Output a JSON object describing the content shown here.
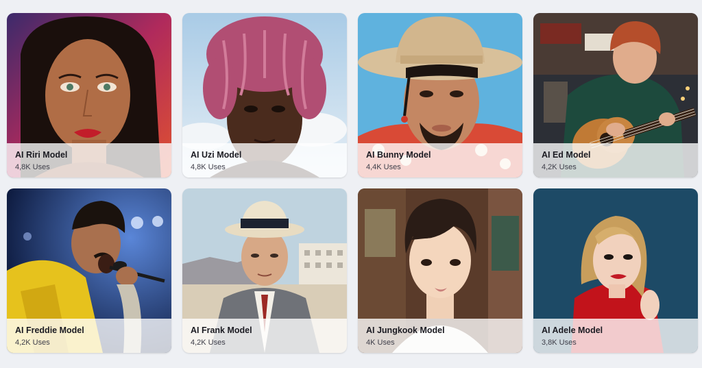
{
  "models": [
    {
      "title": "AI Riri Model",
      "uses": "4,8K Uses",
      "portrait": "woman-red-lips-portrait"
    },
    {
      "title": "AI Uzi Model",
      "uses": "4,8K Uses",
      "portrait": "man-pink-dreadlocks-portrait"
    },
    {
      "title": "AI Bunny Model",
      "uses": "4,4K Uses",
      "portrait": "man-bucket-hat-portrait"
    },
    {
      "title": "AI Ed Model",
      "uses": "4,2K Uses",
      "portrait": "man-playing-guitar-portrait"
    },
    {
      "title": "AI Freddie Model",
      "uses": "4,2K Uses",
      "portrait": "singer-yellow-jacket-microphone"
    },
    {
      "title": "AI Frank Model",
      "uses": "4,2K Uses",
      "portrait": "man-fedora-suit-portrait"
    },
    {
      "title": "AI Jungkook Model",
      "uses": "4K Uses",
      "portrait": "young-man-portrait"
    },
    {
      "title": "AI Adele Model",
      "uses": "3,8K Uses",
      "portrait": "woman-red-dress-portrait"
    }
  ]
}
